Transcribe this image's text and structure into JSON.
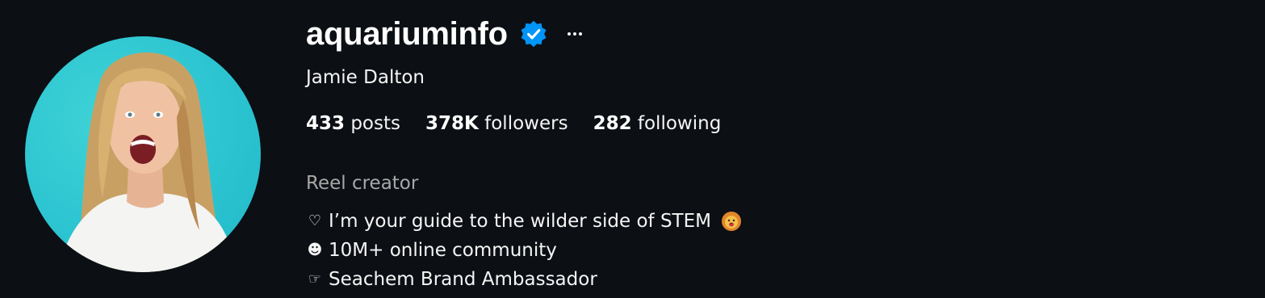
{
  "profile": {
    "username": "aquariuminfo",
    "full_name": "Jamie Dalton",
    "verified_icon": "verified-badge-icon",
    "more_icon": "more-options-icon",
    "accent_color": "#0095f6"
  },
  "stats": {
    "posts_count": "433",
    "posts_label": "posts",
    "followers_count": "378K",
    "followers_label": "followers",
    "following_count": "282",
    "following_label": "following"
  },
  "bio": {
    "category": "Reel creator",
    "lines": [
      {
        "icon": "♡",
        "text": "I’m your guide to the wilder side of STEM",
        "trailing_icon": "lion-face-icon"
      },
      {
        "icon": "☻",
        "text": "10M+ online community"
      },
      {
        "icon": "☞",
        "text": "Seachem Brand Ambassador"
      }
    ]
  }
}
